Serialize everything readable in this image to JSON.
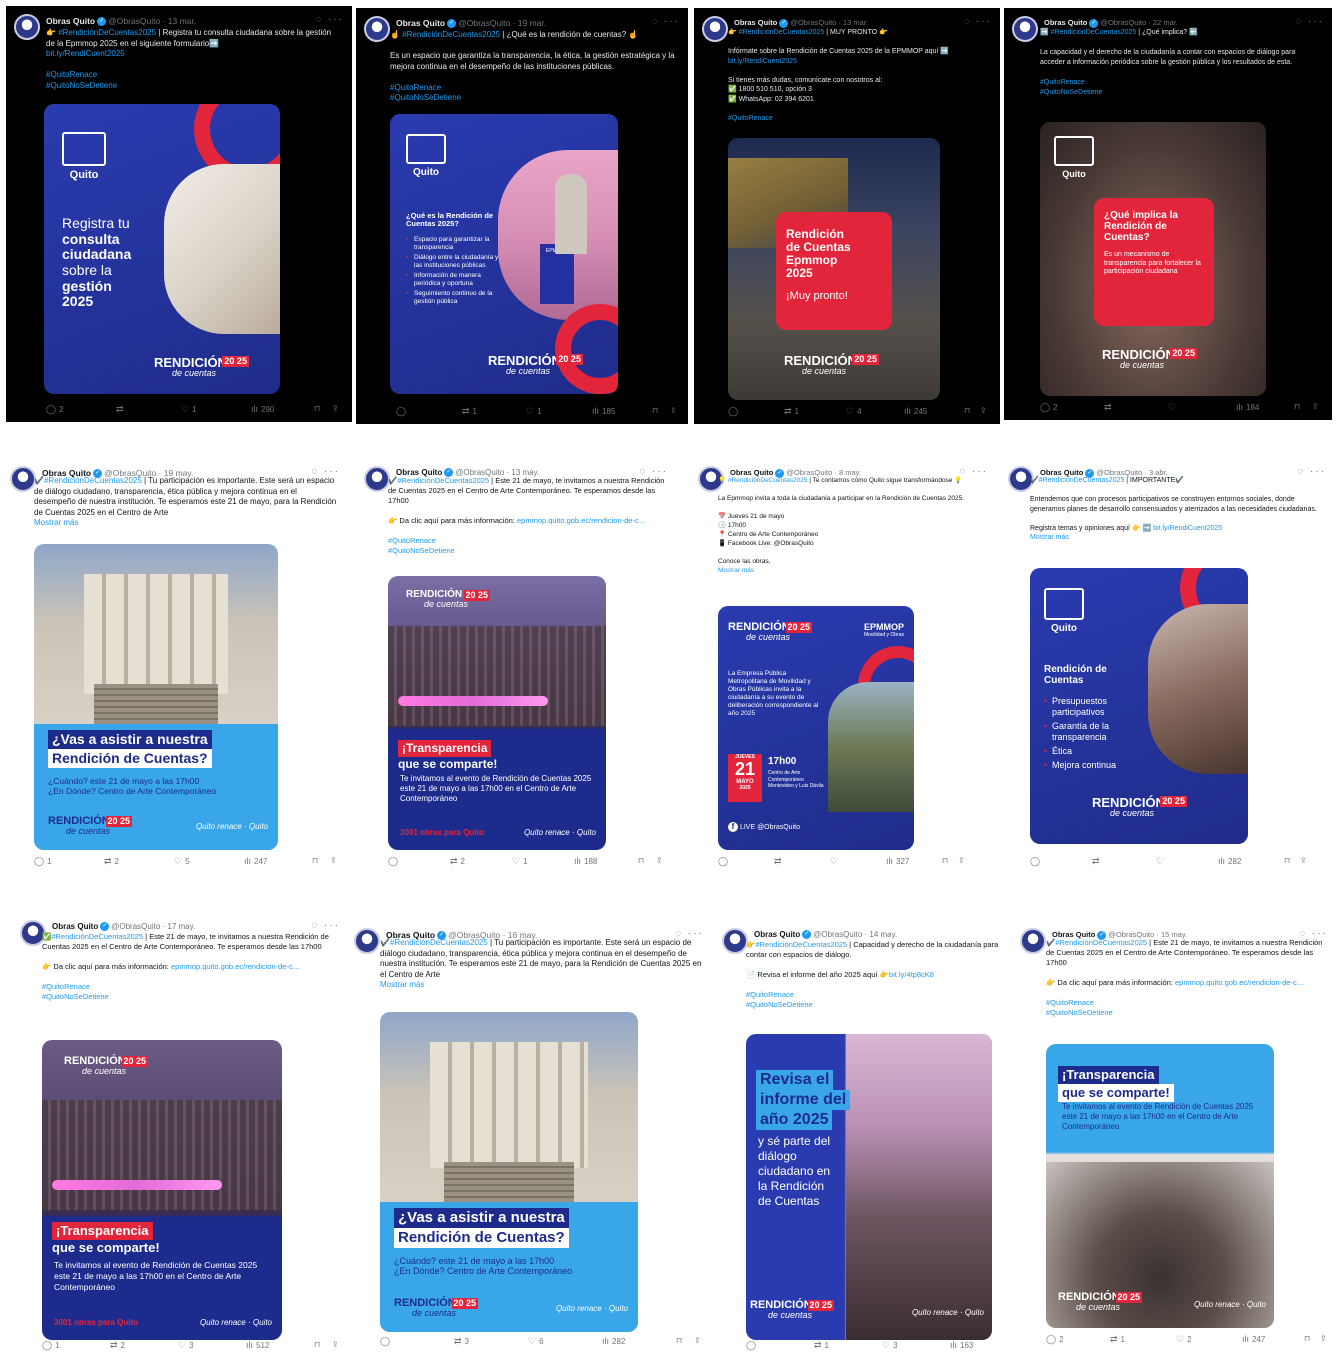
{
  "tweets": [
    {
      "name": "Obras Quito",
      "handle": "@ObrasQuito",
      "date": "· 13 mar.",
      "text": "👉 ",
      "tag1": "#RendiciónDeCuentas2025",
      "text2": " | Registra tu consulta ciudadana sobre la gestión de la Epmmop 2025 en el siguiente formulario➡️",
      "link": "bit.ly/RendiCuent2025",
      "hashtags": [
        "#QuitoRenace",
        "#QuitoNoSeDetiene"
      ],
      "poster": {
        "logo": "Quito",
        "title": [
          "Registra tu",
          "consulta",
          "ciudadana",
          "sobre la",
          "gestión",
          "2025"
        ],
        "brand": "RENDICIÓN",
        "brand_sub": "de cuentas",
        "year": "20 25"
      },
      "actions": {
        "reply": "2",
        "retweet": "",
        "like": "1",
        "views": "290"
      }
    },
    {
      "name": "Obras Quito",
      "handle": "@ObrasQuito",
      "date": "· 19 mar.",
      "text": "☝️ ",
      "tag1": "#RendiciónDeCuentas2025",
      "text2": " | ¿Qué es la rendición de cuentas? ☝️",
      "body": "Es un espacio que garantiza la transparencia, la ética, la gestión estratégica y la mejora continua en el desempeño de las instituciones públicas.",
      "hashtags": [
        "#QuitoRenace",
        "#QuitoNoSeDetiene"
      ],
      "poster": {
        "logo": "Quito",
        "question": "¿Qué es la Rendición de Cuentas 2025?",
        "items": [
          "Espacio para garantizar la transparencia",
          "Diálogo entre la ciudadanía y las instituciones públicas",
          "Información de manera periódica y oportuna",
          "Seguimiento continuo de la gestión pública"
        ],
        "brand": "RENDICIÓN",
        "brand_sub": "de cuentas",
        "year": "20 25",
        "podium": "EPMMOP"
      },
      "actions": {
        "reply": "",
        "retweet": "1",
        "like": "1",
        "views": "185"
      }
    },
    {
      "name": "Obras Quito",
      "handle": "@ObrasQuito",
      "date": "· 13 mar.",
      "text": "👉 ",
      "tag1": "#RendiciónDeCuentas2025",
      "text2": " | MUY PRONTO 👉",
      "body": "Infórmate sobre la Rendición de Cuentas 2025 de la EPMMOP aquí ➡️",
      "link": "bit.ly/RendiCuent2025",
      "body2": "Si tienes más dudas, comunícate con nosotros al:",
      "contacts": [
        "✅ 1800 510 510, opción 3",
        "✅ WhatsApp: 02 394 6201"
      ],
      "hashtags": [
        "#QuitoRenace"
      ],
      "poster": {
        "card": [
          "Rendición",
          "de Cuentas",
          "Epmmop",
          "2025"
        ],
        "soon": "¡Muy pronto!",
        "brand": "RENDICIÓN",
        "brand_sub": "de cuentas",
        "year": "20 25"
      },
      "actions": {
        "reply": "",
        "retweet": "1",
        "like": "4",
        "views": "245"
      }
    },
    {
      "name": "Obras Quito",
      "handle": "@ObrasQuito",
      "date": "· 22 mar.",
      "text": "➡️ ",
      "tag1": "#RendiciónDeCuentas2025",
      "text2": " | ¿Qué implica? ⬅️",
      "body": "La capacidad y el derecho de la ciudadanía a contar con espacios de diálogo para acceder a información periódica sobre la gestión pública y los resultados de esta.",
      "hashtags": [
        "#QuitoRenace",
        "#QuitoNoSeDetiene"
      ],
      "poster": {
        "logo": "Quito",
        "card_title": "¿Qué implica la Rendición de Cuentas?",
        "card_body": "Es un mecanismo de transparencia para fortalecer la participación ciudadana",
        "brand": "RENDICIÓN",
        "brand_sub": "de cuentas",
        "year": "20 25"
      },
      "actions": {
        "reply": "2",
        "retweet": "",
        "like": "",
        "views": "184"
      }
    },
    {
      "name": "Obras Quito",
      "handle": "@ObrasQuito",
      "date": "· 19 may.",
      "text": "✔️",
      "tag1": "#RendiciónDeCuentas2025",
      "text2": " | Tu participación es importante. Este será un espacio de diálogo ciudadano, transparencia, ética pública y mejora continua en el desempeño de nuestra institución. Te esperamos este 21 de mayo, para la Rendición de Cuentas 2025 en el Centro de Arte",
      "more": "Mostrar más",
      "poster": {
        "q1": "¿Vas a asistir a nuestra",
        "q2": "Rendición de Cuentas?",
        "when": "¿Cuándo? este 21 de mayo a las 17h00",
        "where": "¿En Dónde? Centro de Arte Contemporáneo",
        "brand": "RENDICIÓN",
        "brand_sub": "de cuentas",
        "year": "20 25",
        "footer": "Quito renace · Quito"
      },
      "actions": {
        "reply": "1",
        "retweet": "2",
        "like": "5",
        "views": "247"
      }
    },
    {
      "name": "Obras Quito",
      "handle": "@ObrasQuito",
      "date": "· 13 may.",
      "text": "✔️",
      "tag1": "#RendiciónDeCuentas2025",
      "text2": " | Este 21 de mayo, te invitamos a nuestra Rendición de Cuentas 2025 en el Centro de Arte Contemporáneo. Te esperamos desde las 17h00",
      "body": "👉 Da clic aquí para más información:",
      "link": "epmmop.quito.gob.ec/rendicion-de-c…",
      "hashtags": [
        "#QuitoRenace",
        "#QuitoNoSeDetiene"
      ],
      "poster": {
        "l1": "¡Transparencia",
        "l2": "que se comparte!",
        "invite": "Te invitamos al evento de Rendición de Cuentas 2025 este 21 de mayo a las 17h00 en el Centro de Arte Contemporáneo",
        "brand": "RENDICIÓN",
        "brand_sub": "de cuentas",
        "year": "20 25",
        "footer_left": "3001 obras para Quito",
        "footer": "Quito renace · Quito"
      },
      "actions": {
        "reply": "",
        "retweet": "2",
        "like": "1",
        "views": "188"
      }
    },
    {
      "name": "Obras Quito",
      "handle": "@ObrasQuito",
      "date": "· 8 may.",
      "text": "💡 ",
      "tag1": "#RendiciónDeCuentas2025",
      "text2": " | Te contamos cómo Quito sigue transformándose 💡",
      "body": "La Epmmop invita a toda la ciudadanía a participar en la Rendición de Cuentas 2025.",
      "details": [
        "📅 Jueves 21 de mayo",
        "🕔 17h00",
        "📍 Centro de Arte Contemporáneo",
        "📱 Facebook Live: @ObrasQuito"
      ],
      "body2": "Conoce las obras,",
      "more": "Mostrar más",
      "poster": {
        "brand": "RENDICIÓN",
        "brand_sub": "de cuentas",
        "year": "20 25",
        "epm": "EPMMOP",
        "epm_sub": "Movilidad y Obras",
        "desc": "La Empresa Pública Metropolitana de Movilidad y Obras Públicas invita a la ciudadanía a su evento de deliberación correspondiente al año 2025",
        "day_name": "JUEVES",
        "day": "21",
        "month": "MAYO",
        "year_full": "2025",
        "time": "17h00",
        "venue": "Centro de Arte Contemporáneo Montevideo y Luis Dávila",
        "live": "LIVE @ObrasQuito"
      },
      "actions": {
        "reply": "",
        "retweet": "",
        "like": "",
        "views": "327"
      }
    },
    {
      "name": "Obras Quito",
      "handle": "@ObrasQuito",
      "date": "· 3 abr.",
      "text": "✔️",
      "tag1": "#RendiciónDeCuentas2025",
      "text2": " | IMPORTANTE✔️",
      "body": "Entendemos que con procesos participativos se construyen entornos sociales, donde generamos planes de desarrollo consensuados y aterrizados a las necesidades ciudadanas.",
      "body2": "Registra temas y opiniones aquí 👉 ➡️",
      "link": "bit.ly/RendiCuent2025",
      "more": "Mostrar más",
      "poster": {
        "logo": "Quito",
        "title": "Rendición de Cuentas",
        "items": [
          "Presupuestos participativos",
          "Garantía de la transparencia",
          "Ética",
          "Mejora continua"
        ],
        "brand": "RENDICIÓN",
        "brand_sub": "de cuentas",
        "year": "20 25"
      },
      "actions": {
        "reply": "",
        "retweet": "",
        "like": "",
        "views": "282"
      }
    },
    {
      "name": "Obras Quito",
      "handle": "@ObrasQuito",
      "date": "· 17 may.",
      "text": "✅",
      "tag1": "#RendiciónDeCuentas2025",
      "text2": " | Este 21 de mayo, te invitamos a nuestra Rendición de Cuentas 2025 en el Centro de Arte Contemporáneo. Te esperamos desde las 17h00",
      "body": "👉 Da clic aquí para más información:",
      "link": "epmmop.quito.gob.ec/rendicion-de-c…",
      "hashtags": [
        "#QuitoRenace",
        "#QuitoNoSeDetiene"
      ],
      "poster": {
        "l1": "¡Transparencia",
        "l2": "que se comparte!",
        "invite": "Te invitamos al evento de Rendición de Cuentas 2025 este 21 de mayo a las 17h00 en el Centro de Arte Contemporáneo",
        "brand": "RENDICIÓN",
        "brand_sub": "de cuentas",
        "year": "20 25",
        "footer_left": "3001 obras para Quito",
        "footer": "Quito renace · Quito"
      },
      "actions": {
        "reply": "1",
        "retweet": "2",
        "like": "3",
        "views": "512"
      }
    },
    {
      "name": "Obras Quito",
      "handle": "@ObrasQuito",
      "date": "· 16 may.",
      "text": "✔️",
      "tag1": "#RendiciónDeCuentas2025",
      "text2": " | Tu participación es importante. Este será un espacio de diálogo ciudadano, transparencia, ética pública y mejora continua en el desempeño de nuestra institución. Te esperamos este 21 de mayo, para la Rendición de Cuentas 2025 en el Centro de Arte",
      "more": "Mostrar más",
      "poster": {
        "q1": "¿Vas a asistir a nuestra",
        "q2": "Rendición de Cuentas?",
        "when": "¿Cuándo? este 21 de mayo a las 17h00",
        "where": "¿En Dónde? Centro de Arte Contemporáneo",
        "brand": "RENDICIÓN",
        "brand_sub": "de cuentas",
        "year": "20 25",
        "footer": "Quito renace · Quito"
      },
      "actions": {
        "reply": "",
        "retweet": "3",
        "like": "6",
        "views": "282"
      }
    },
    {
      "name": "Obras Quito",
      "handle": "@ObrasQuito",
      "date": "· 14 may.",
      "text": "👉",
      "tag1": "#RendiciónDeCuentas2025",
      "text2": " | Capacidad y derecho de la ciudadanía para contar con espacios de diálogo.",
      "body": "📄 Revisa el informe del año 2025 aquí 👉",
      "link": "bit.ly/4tp8cK8",
      "hashtags": [
        "#QuitoRenace",
        "#QuitoNoSeDetiene"
      ],
      "poster": {
        "t1": "Revisa el",
        "t2": "informe del",
        "t3": "año 2025",
        "sub": "y sé parte del diálogo ciudadano en la Rendición de Cuentas",
        "brand": "RENDICIÓN",
        "brand_sub": "de cuentas",
        "year": "20 25",
        "footer": "Quito renace · Quito"
      },
      "actions": {
        "reply": "",
        "retweet": "1",
        "like": "3",
        "views": "163"
      }
    },
    {
      "name": "Obras Quito",
      "handle": "@ObrasQuito",
      "date": "· 15 may.",
      "text": "✔️",
      "tag1": "#RendiciónDeCuentas2025",
      "text2": " | Este 21 de mayo, te invitamos a nuestra Rendición de Cuentas 2025 en el Centro de Arte Contemporáneo. Te esperamos desde las 17h00",
      "body": "👉 Da clic aquí para más información:",
      "link": "epmmop.quito.gob.ec/rendicion-de-c…",
      "hashtags": [
        "#QuitoRenace",
        "#QuitoNoSeDetiene"
      ],
      "poster": {
        "l1": "¡Transparencia",
        "l2": "que se comparte!",
        "invite": "Te invitamos al evento de Rendición de Cuentas 2025 este 21 de mayo a las 17h00 en el Centro de Arte Contemporáneo",
        "brand": "RENDICIÓN",
        "brand_sub": "de cuentas",
        "year": "20 25",
        "footer": "Quito renace · Quito"
      },
      "actions": {
        "reply": "2",
        "retweet": "1",
        "like": "2",
        "views": "247"
      }
    }
  ],
  "colors": {
    "brand_blue": "#2a3bb0",
    "brand_red": "#e3253b",
    "link": "#1d9bf0",
    "light_blue": "#38a6e8"
  },
  "icons": {
    "reply": "reply-icon",
    "retweet": "retweet-icon",
    "like": "heart-icon",
    "views": "views-icon",
    "bookmark": "bookmark-icon",
    "share": "share-icon",
    "grok": "grok-icon",
    "more": "more-icon"
  }
}
